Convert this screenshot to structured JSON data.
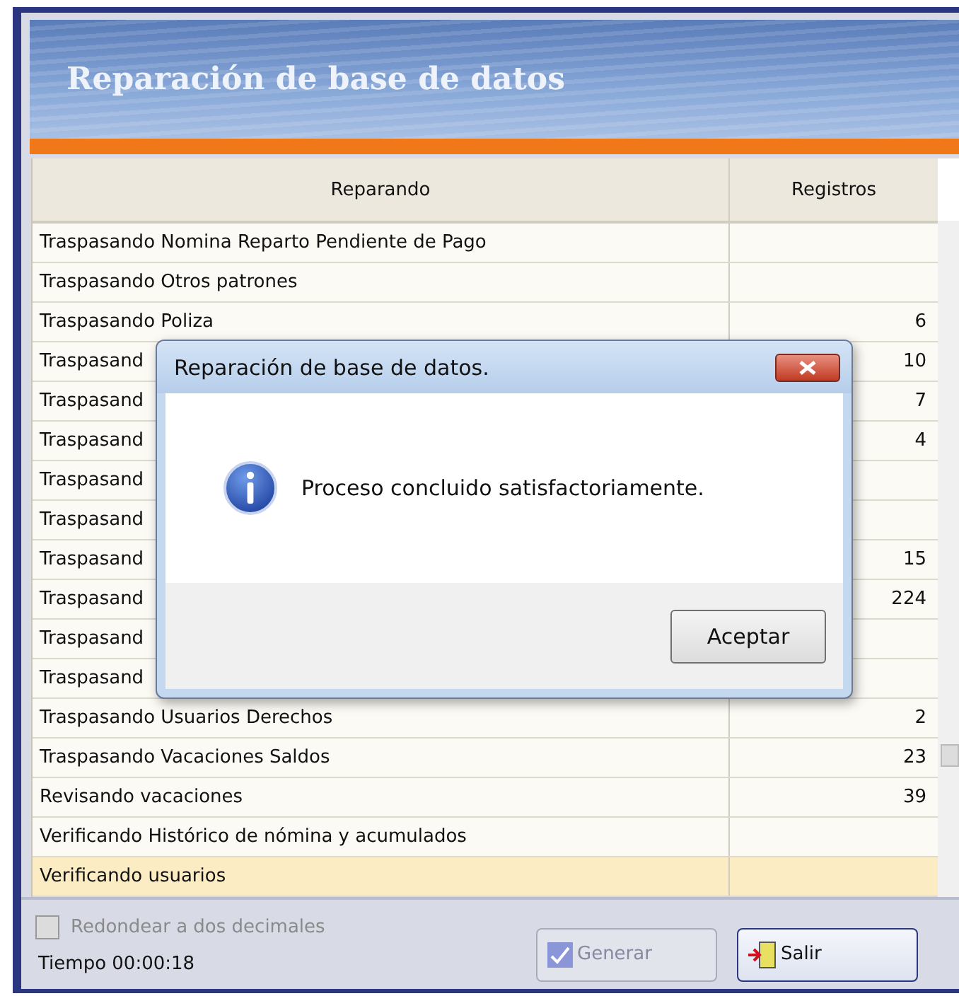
{
  "window": {
    "title": "Reparación de base de datos"
  },
  "table": {
    "columns": [
      "Reparando",
      "Registros"
    ],
    "rows": [
      {
        "task": "Traspasando Nomina Reparto Pendiente de Pago",
        "count": "",
        "selected": false
      },
      {
        "task": "Traspasando Otros patrones",
        "count": "",
        "selected": false
      },
      {
        "task": "Traspasando Poliza",
        "count": "6",
        "selected": false
      },
      {
        "task": "Traspasand",
        "count": "10",
        "selected": false
      },
      {
        "task": "Traspasand",
        "count": "7",
        "selected": false
      },
      {
        "task": "Traspasand",
        "count": "4",
        "selected": false
      },
      {
        "task": "Traspasand",
        "count": "",
        "selected": false
      },
      {
        "task": "Traspasand",
        "count": "",
        "selected": false
      },
      {
        "task": "Traspasand",
        "count": "15",
        "selected": false
      },
      {
        "task": "Traspasand",
        "count": "224",
        "selected": false
      },
      {
        "task": "Traspasand",
        "count": "",
        "selected": false
      },
      {
        "task": "Traspasand",
        "count": "",
        "selected": false
      },
      {
        "task": "Traspasando Usuarios Derechos",
        "count": "2",
        "selected": false
      },
      {
        "task": "Traspasando Vacaciones Saldos",
        "count": "23",
        "selected": false
      },
      {
        "task": "Revisando vacaciones",
        "count": "39",
        "selected": false
      },
      {
        "task": "Verificando Histórico de nómina y acumulados",
        "count": "",
        "selected": false
      },
      {
        "task": "Verificando usuarios",
        "count": "",
        "selected": true
      }
    ]
  },
  "footer": {
    "round_checkbox": {
      "label": "Redondear a dos decimales",
      "checked": false,
      "disabled": true
    },
    "time": "Tiempo 00:00:18",
    "buttons": [
      {
        "label": "Generar",
        "kind": "generate",
        "disabled": true
      },
      {
        "label": "Salir",
        "kind": "exit",
        "disabled": false
      }
    ]
  },
  "dialog": {
    "title": "Reparación de base de datos.",
    "message": "Proceso concluido satisfactoriamente.",
    "button": "Aceptar"
  }
}
